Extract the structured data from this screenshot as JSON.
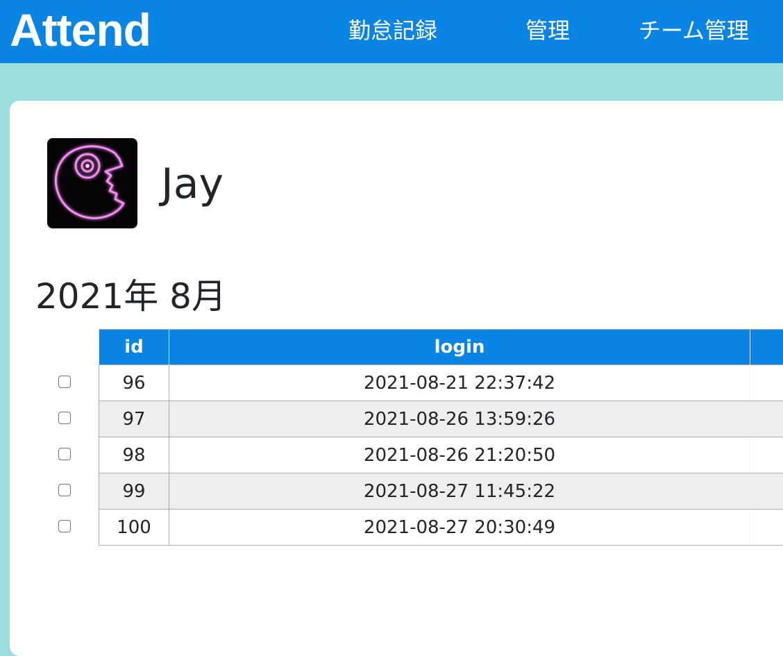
{
  "nav": {
    "brand": "Attend",
    "links": [
      "勤怠記録",
      "管理",
      "チーム管理"
    ]
  },
  "profile": {
    "name": "Jay",
    "avatar_icon": "neon-pacman-avatar-icon"
  },
  "month_title": "2021年 8月",
  "table": {
    "headers": [
      "id",
      "login",
      ""
    ],
    "rows": [
      {
        "id": "96",
        "login": "2021-08-21 22:37:42",
        "checked": false
      },
      {
        "id": "97",
        "login": "2021-08-26 13:59:26",
        "checked": false
      },
      {
        "id": "98",
        "login": "2021-08-26 21:20:50",
        "checked": false
      },
      {
        "id": "99",
        "login": "2021-08-27 11:45:22",
        "checked": false
      },
      {
        "id": "100",
        "login": "2021-08-27 20:30:49",
        "checked": false
      }
    ]
  },
  "colors": {
    "primary": "#0984e3",
    "background": "#9addda",
    "row_alt": "#eeeeee"
  }
}
